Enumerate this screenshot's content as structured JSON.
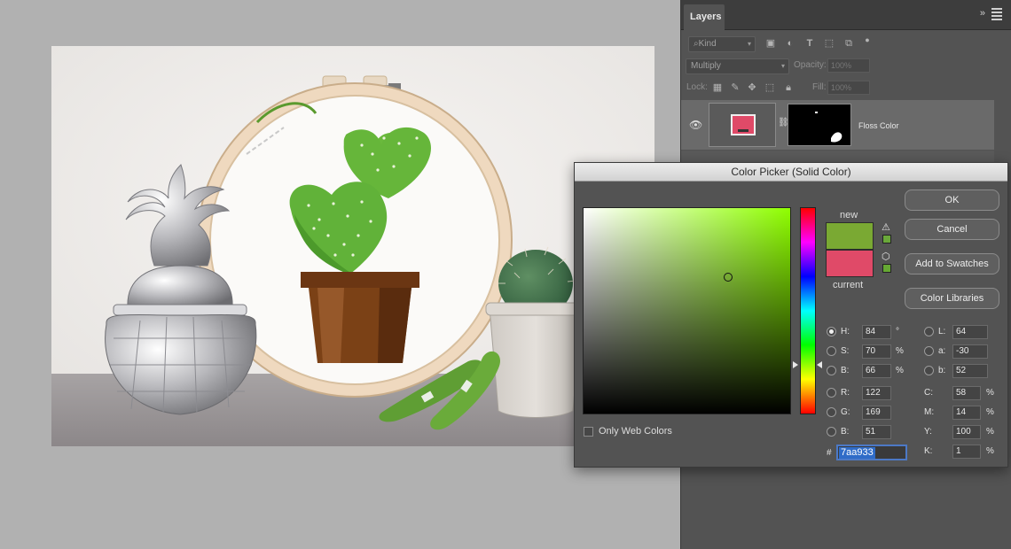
{
  "layers_panel": {
    "tab_label": "Layers",
    "collapse_glyph": "»",
    "kind_filter": "Kind",
    "blend_mode": "Multiply",
    "opacity_label": "Opacity:",
    "opacity_value": "100%",
    "lock_label": "Lock:",
    "fill_label": "Fill:",
    "fill_value": "100%",
    "layer_name": "Floss Color"
  },
  "color_picker": {
    "title": "Color Picker (Solid Color)",
    "new_label": "new",
    "current_label": "current",
    "new_color": "#7aa933",
    "current_color": "#e04a68",
    "buttons": {
      "ok": "OK",
      "cancel": "Cancel",
      "add_to_swatches": "Add to Swatches",
      "color_libraries": "Color Libraries"
    },
    "hsb": {
      "h_label": "H:",
      "h_value": "84",
      "h_unit": "°",
      "s_label": "S:",
      "s_value": "70",
      "s_unit": "%",
      "b_label": "B:",
      "b_value": "66",
      "b_unit": "%"
    },
    "rgb": {
      "r_label": "R:",
      "r_value": "122",
      "g_label": "G:",
      "g_value": "169",
      "b_label": "B:",
      "b_value": "51"
    },
    "lab": {
      "l_label": "L:",
      "l_value": "64",
      "a_label": "a:",
      "a_value": "-30",
      "b_label": "b:",
      "b_value": "52"
    },
    "cmyk": {
      "c_label": "C:",
      "c_value": "58",
      "m_label": "M:",
      "m_value": "14",
      "y_label": "Y:",
      "y_value": "100",
      "k_label": "K:",
      "k_value": "1",
      "unit": "%"
    },
    "only_web_colors_label": "Only Web Colors",
    "hex_hash": "#",
    "hex_value": "7aa933"
  }
}
